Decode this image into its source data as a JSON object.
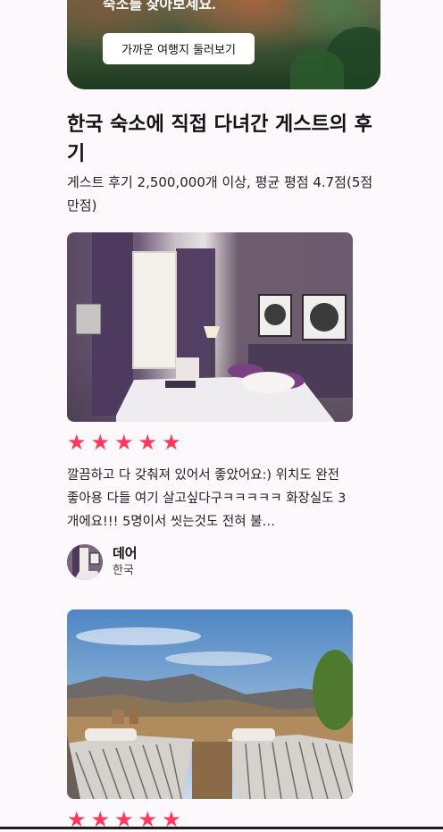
{
  "hero": {
    "heading": "숙소를 찾아보세요.",
    "button_label": "가까운 여행지 둘러보기"
  },
  "reviews_section": {
    "title": "한국 숙소에 직접 다녀간 게스트의 후기",
    "subtitle": "게스트 후기 2,500,000개 이상, 평균 평점 4.7점(5점 만점)"
  },
  "reviews": [
    {
      "rating": 5,
      "text": "깔끔하고 다 갖춰져 있어서 좋았어요:) 위치도 완전 좋아용 다들 여기 살고싶다구ㅋㅋㅋㅋㅋ 화장실도 3개에요!!! 5명이서 씻는것도 전혀 불…",
      "author_name": "데어",
      "author_country": "한국"
    },
    {
      "rating": 5
    }
  ],
  "colors": {
    "star": "#ff385c",
    "background": "#fcf8fc"
  },
  "icons": {
    "star": "star-icon"
  }
}
